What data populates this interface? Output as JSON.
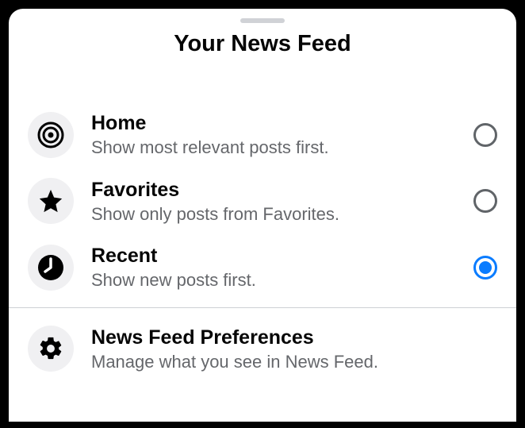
{
  "header": {
    "title": "Your News Feed"
  },
  "options": [
    {
      "id": "home",
      "title": "Home",
      "subtitle": "Show most relevant posts first.",
      "selected": false
    },
    {
      "id": "favorites",
      "title": "Favorites",
      "subtitle": "Show only posts from Favorites.",
      "selected": false
    },
    {
      "id": "recent",
      "title": "Recent",
      "subtitle": "Show new posts first.",
      "selected": true
    }
  ],
  "preferences": {
    "title": "News Feed Preferences",
    "subtitle": "Manage what you see in News Feed."
  }
}
